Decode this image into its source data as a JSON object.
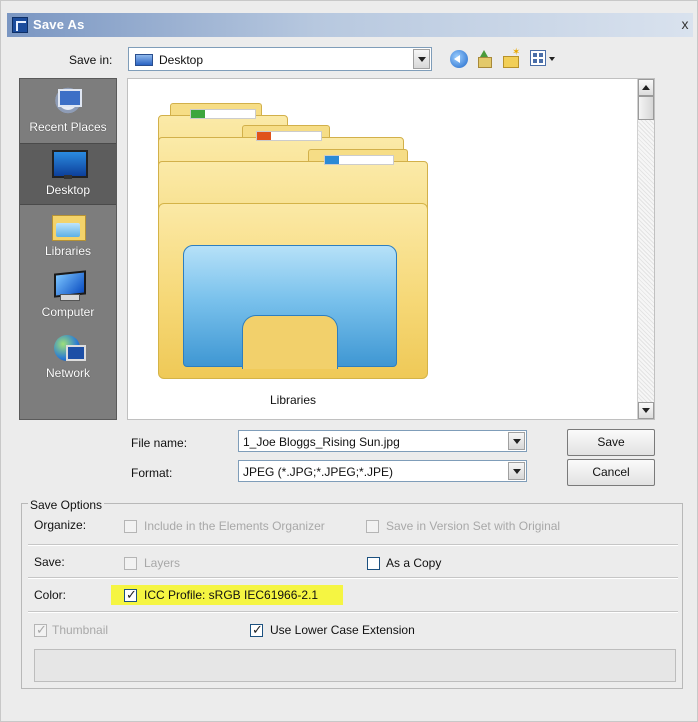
{
  "window": {
    "title": "Save As",
    "close": "x"
  },
  "save_in": {
    "label": "Save in:",
    "value": "Desktop"
  },
  "places": [
    {
      "label": "Recent Places",
      "icon": "recent-places-icon"
    },
    {
      "label": "Desktop",
      "icon": "desktop-icon",
      "active": true
    },
    {
      "label": "Libraries",
      "icon": "libraries-icon"
    },
    {
      "label": "Computer",
      "icon": "computer-icon"
    },
    {
      "label": "Network",
      "icon": "network-icon"
    }
  ],
  "files": [
    {
      "name": "Libraries",
      "icon": "libraries-folder-icon"
    }
  ],
  "file_name": {
    "label": "File name:",
    "value": "1_Joe Bloggs_Rising Sun.jpg"
  },
  "format": {
    "label": "Format:",
    "value": "JPEG (*.JPG;*.JPEG;*.JPE)"
  },
  "buttons": {
    "save": "Save",
    "cancel": "Cancel"
  },
  "save_options": {
    "legend": "Save Options",
    "organize_label": "Organize:",
    "include_organizer": {
      "label": "Include in the Elements Organizer",
      "checked": false,
      "enabled": false
    },
    "version_set": {
      "label": "Save in Version Set with Original",
      "checked": false,
      "enabled": false
    },
    "save_label": "Save:",
    "layers": {
      "label": "Layers",
      "checked": false,
      "enabled": false
    },
    "as_copy": {
      "label": "As a Copy",
      "checked": false,
      "enabled": true
    },
    "color_label": "Color:",
    "icc_profile": {
      "label": "ICC Profile:  sRGB IEC61966-2.1",
      "checked": true,
      "enabled": true,
      "highlight": "#f5f542"
    },
    "thumbnail": {
      "label": "Thumbnail",
      "checked": true,
      "enabled": false
    },
    "lowercase_ext": {
      "label": "Use Lower Case Extension",
      "checked": true,
      "enabled": true
    }
  },
  "colors": {
    "places_bg": "#7d7d7d",
    "title_bar": "#7a96c2",
    "highlight": "#f5f542"
  }
}
